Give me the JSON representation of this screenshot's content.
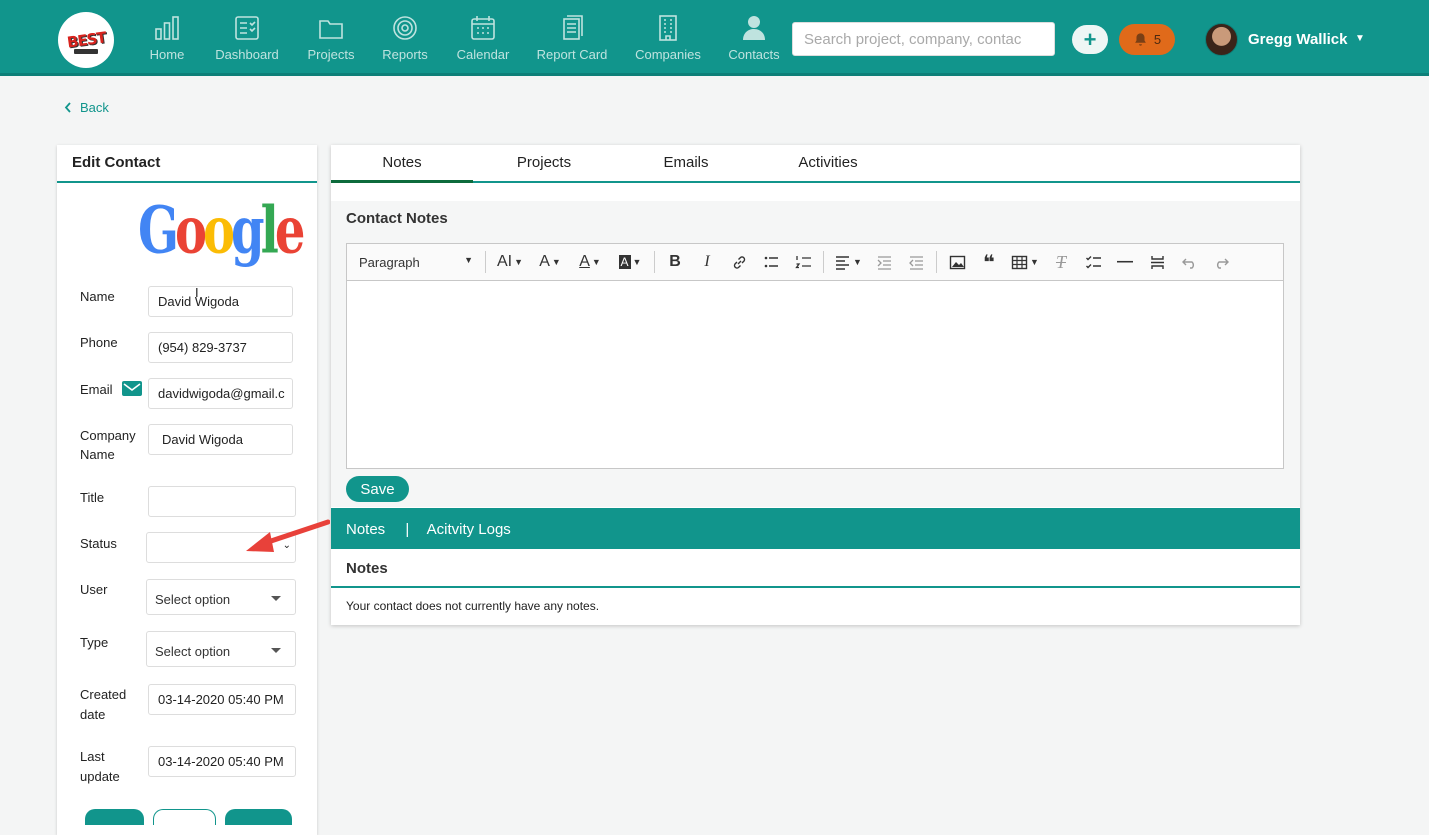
{
  "logo": {
    "text": "BEST"
  },
  "nav": [
    {
      "id": "home",
      "label": "Home"
    },
    {
      "id": "dashboard",
      "label": "Dashboard"
    },
    {
      "id": "projects",
      "label": "Projects"
    },
    {
      "id": "reports",
      "label": "Reports"
    },
    {
      "id": "calendar",
      "label": "Calendar"
    },
    {
      "id": "reportcard",
      "label": "Report Card"
    },
    {
      "id": "companies",
      "label": "Companies"
    },
    {
      "id": "contacts",
      "label": "Contacts"
    }
  ],
  "search": {
    "placeholder": "Search project, company, contac"
  },
  "plus": {
    "label": "+"
  },
  "notifications": {
    "count": "5"
  },
  "user": {
    "name": "Gregg Wallick",
    "caret": "▼"
  },
  "back": {
    "label": "Back"
  },
  "edit_contact": {
    "title": "Edit Contact",
    "logo_letters": [
      "G",
      "o",
      "o",
      "g",
      "l",
      "e"
    ],
    "fields": {
      "name": {
        "label": "Name",
        "value": "David Wigoda"
      },
      "phone": {
        "label": "Phone",
        "value": "(954) 829-3737"
      },
      "email": {
        "label": "Email",
        "value": "davidwigoda@gmail.c"
      },
      "company": {
        "label_line1": "Company",
        "label_line2": "Name",
        "value": "David Wigoda"
      },
      "title": {
        "label": "Title",
        "value": ""
      },
      "status": {
        "label": "Status",
        "value": ""
      },
      "user": {
        "label": "User",
        "value": "Select option"
      },
      "type": {
        "label": "Type",
        "value": "Select option"
      },
      "created": {
        "label_line1": "Created",
        "label_line2": "date",
        "value": "03-14-2020 05:40 PM"
      },
      "updated": {
        "label_line1": "Last",
        "label_line2": "update",
        "value": "03-14-2020 05:40 PM"
      }
    }
  },
  "tabs": [
    {
      "label": "Notes",
      "active": true
    },
    {
      "label": "Projects",
      "active": false
    },
    {
      "label": "Emails",
      "active": false
    },
    {
      "label": "Activities",
      "active": false
    }
  ],
  "contact_notes": {
    "title": "Contact Notes",
    "toolbar": {
      "paragraph": "Paragraph",
      "font_size": "AI",
      "font_family": "A",
      "font_color": "A",
      "bg_color": "A",
      "bold": "B",
      "italic": "I",
      "quote": "❝",
      "clear": "T",
      "line": "—"
    },
    "save_label": "Save"
  },
  "sub_bar": {
    "notes": "Notes",
    "separator": "|",
    "activity": "Acitvity Logs"
  },
  "notes_section": {
    "title": "Notes",
    "empty_message": "Your contact does not currently have any notes."
  },
  "colors": {
    "brand": "#11958c",
    "notification": "#e06a1a",
    "arrow": "#e8413a"
  }
}
